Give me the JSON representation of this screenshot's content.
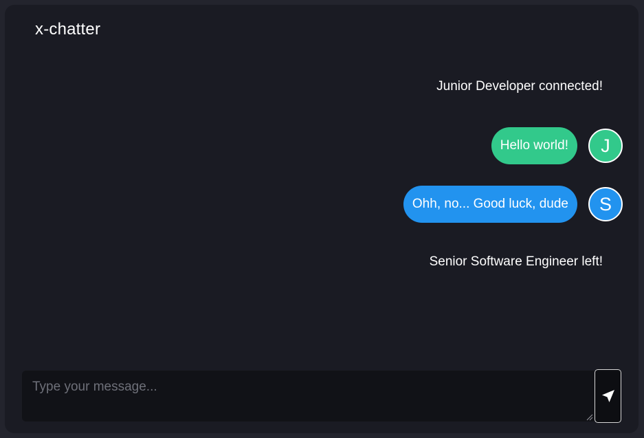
{
  "app": {
    "title": "x-chatter"
  },
  "messages": {
    "system_join": "Junior Developer connected!",
    "chat": [
      {
        "text": "Hello world!",
        "avatar_initial": "J",
        "color": "#32c98b"
      },
      {
        "text": "Ohh, no... Good luck, dude",
        "avatar_initial": "S",
        "color": "#2293ef"
      }
    ],
    "system_leave": "Senior Software Engineer left!"
  },
  "composer": {
    "placeholder": "Type your message...",
    "value": "",
    "send_icon": "send-icon"
  },
  "colors": {
    "background": "#1a1b23",
    "input_background": "#111217"
  }
}
